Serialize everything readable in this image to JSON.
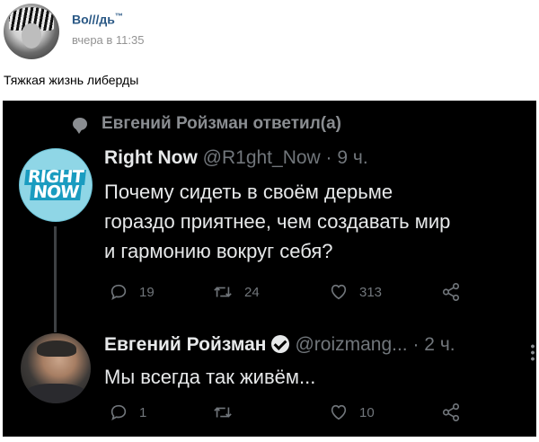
{
  "post": {
    "author": "Во///дь",
    "author_mark": "™",
    "time": "вчера в 11:35",
    "text": "Тяжкая жизнь либерды"
  },
  "tweet_screenshot": {
    "reply_banner": "Евгений Ройзман ответил(а)",
    "tweet1": {
      "avatar_text": [
        "RIGHT",
        "NOW"
      ],
      "name": "Right Now",
      "handle_time": "@R1ght_Now · 9 ч.",
      "lines": [
        "Почему сидеть в своём дерьме",
        "гораздо приятнее, чем создавать мир",
        "и гармонию вокруг себя?"
      ],
      "replies": "19",
      "retweets": "24",
      "likes": "313"
    },
    "tweet2": {
      "name": "Евгений Ройзман",
      "handle_time": "@roizmang... · 2 ч.",
      "text": "Мы всегда так живём...",
      "replies": "1",
      "retweets": "",
      "likes": "10"
    }
  },
  "colors": {
    "vk_link": "#2a5885",
    "vk_meta": "#939393",
    "tweet_bg": "#000000",
    "tweet_text": "#e7e9ea",
    "tweet_meta": "#71767b"
  },
  "icons": [
    "reply-icon",
    "retweet-icon",
    "like-icon",
    "share-icon",
    "verified-icon",
    "more-icon"
  ]
}
